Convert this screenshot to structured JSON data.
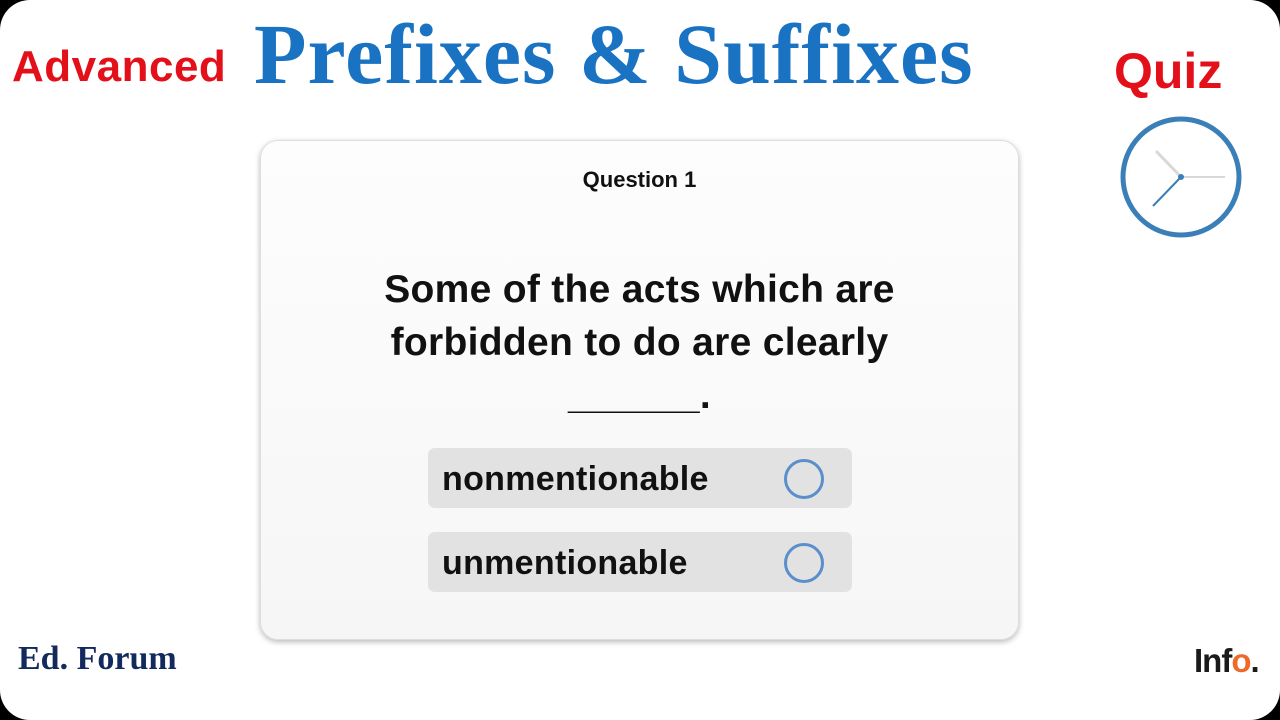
{
  "header": {
    "left_word": "Advanced",
    "title": "Prefixes & Suffixes",
    "right_word": "Quiz"
  },
  "timer": {
    "icon": "clock-icon"
  },
  "quiz": {
    "question_number": "Question 1",
    "question_text": "Some of the acts which are forbidden to do are clearly ______.",
    "options": [
      {
        "label": "nonmentionable",
        "selected": false
      },
      {
        "label": "unmentionable",
        "selected": false
      }
    ]
  },
  "footer": {
    "left_brand": "Ed. Forum",
    "right_brand_main": "Inf",
    "right_brand_accent": "o",
    "right_brand_dot": "."
  },
  "colors": {
    "title_blue": "#1a73c2",
    "accent_red": "#e3101a",
    "radio_blue": "#5b8fcb",
    "brand_navy": "#132a5e",
    "brand_orange": "#ee6a2a"
  }
}
